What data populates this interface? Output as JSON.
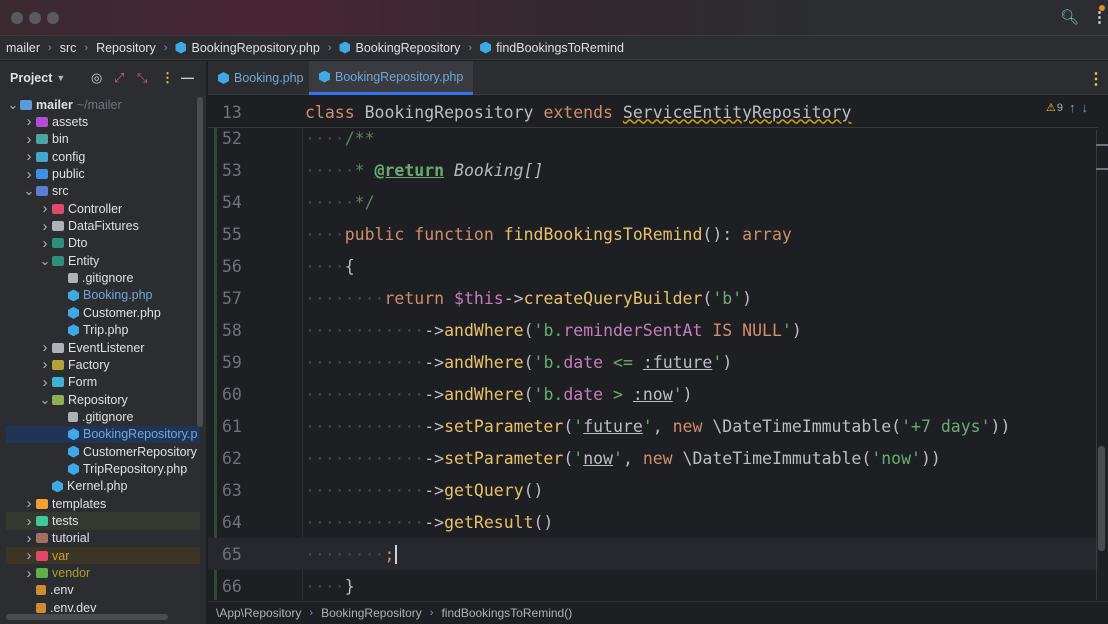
{
  "breadcrumb": [
    "mailer",
    "src",
    "Repository",
    "BookingRepository.php",
    "BookingRepository",
    "findBookingsToRemind"
  ],
  "project_panel": {
    "title": "Project",
    "tree": [
      {
        "label": "mailer",
        "hint": "~/mailer",
        "level": 0,
        "open": true,
        "color": "#5b9bd5"
      },
      {
        "label": "assets",
        "level": 1,
        "color": "#b04fd6"
      },
      {
        "label": "bin",
        "level": 1,
        "color": "#4aa6a6"
      },
      {
        "label": "config",
        "level": 1,
        "color": "#3fa9c9"
      },
      {
        "label": "public",
        "level": 1,
        "color": "#3f8fe6"
      },
      {
        "label": "src",
        "level": 1,
        "open": true,
        "color": "#5b7dd6"
      },
      {
        "label": "Controller",
        "level": 2,
        "color": "#e0476a"
      },
      {
        "label": "DataFixtures",
        "level": 2,
        "color": "#aeb1b6"
      },
      {
        "label": "Dto",
        "level": 2,
        "color": "#2f8f7a"
      },
      {
        "label": "Entity",
        "level": 2,
        "open": true,
        "color": "#2f8f7a"
      },
      {
        "label": ".gitignore",
        "level": 3,
        "leaf": true,
        "color": "#aeb1b6"
      },
      {
        "label": "Booking.php",
        "level": 3,
        "leaf": true,
        "php": true,
        "text": "#6fa8dc"
      },
      {
        "label": "Customer.php",
        "level": 3,
        "leaf": true,
        "php": true
      },
      {
        "label": "Trip.php",
        "level": 3,
        "leaf": true,
        "php": true
      },
      {
        "label": "EventListener",
        "level": 2,
        "color": "#aeb1b6"
      },
      {
        "label": "Factory",
        "level": 2,
        "color": "#b2a33a"
      },
      {
        "label": "Form",
        "level": 2,
        "color": "#3fb0d6"
      },
      {
        "label": "Repository",
        "level": 2,
        "open": true,
        "color": "#8fae5a"
      },
      {
        "label": ".gitignore",
        "level": 3,
        "leaf": true,
        "color": "#aeb1b6"
      },
      {
        "label": "BookingRepository.p",
        "level": 3,
        "leaf": true,
        "php": true,
        "selected": true,
        "text": "#6fa8dc"
      },
      {
        "label": "CustomerRepository",
        "level": 3,
        "leaf": true,
        "php": true
      },
      {
        "label": "TripRepository.php",
        "level": 3,
        "leaf": true,
        "php": true
      },
      {
        "label": "Kernel.php",
        "level": 2,
        "leaf": true,
        "php": true
      },
      {
        "label": "templates",
        "level": 1,
        "color": "#f0a030"
      },
      {
        "label": "tests",
        "level": 1,
        "color": "#3fc99a",
        "bg": "#33392f"
      },
      {
        "label": "tutorial",
        "level": 1,
        "color": "#a07060"
      },
      {
        "label": "var",
        "level": 1,
        "color": "#e0476a",
        "bg": "#3b3525",
        "text": "#c7a03a"
      },
      {
        "label": "vendor",
        "level": 1,
        "color": "#5fae4a",
        "text": "#a8a030"
      },
      {
        "label": ".env",
        "level": 1,
        "leaf": true,
        "color": "#d08a30"
      },
      {
        "label": ".env.dev",
        "level": 1,
        "leaf": true,
        "color": "#d08a30"
      }
    ]
  },
  "tabs": [
    "Booking.php",
    "BookingRepository.php"
  ],
  "inspections": {
    "warnings": "9"
  },
  "sticky": {
    "line": "13",
    "tokens": [
      [
        "class",
        "kw"
      ],
      [
        " ",
        "ws"
      ],
      [
        "BookingRepository",
        "cls"
      ],
      [
        " ",
        "ws"
      ],
      [
        "extends",
        "kw"
      ],
      [
        " ",
        "ws"
      ],
      [
        "ServiceEntityRepository",
        "cls ul"
      ]
    ]
  },
  "lines": [
    {
      "n": "52",
      "t": [
        [
          "····",
          "ws"
        ],
        [
          "/**",
          "doc"
        ]
      ]
    },
    {
      "n": "53",
      "t": [
        [
          "·····",
          "ws"
        ],
        [
          "* ",
          "doc"
        ],
        [
          "@return",
          "tag"
        ],
        [
          " Booking[]",
          "dt"
        ]
      ]
    },
    {
      "n": "54",
      "t": [
        [
          "·····",
          "ws"
        ],
        [
          "*/",
          "doc"
        ]
      ]
    },
    {
      "n": "55",
      "t": [
        [
          "····",
          "ws"
        ],
        [
          "public",
          "kw"
        ],
        [
          " ",
          "ws"
        ],
        [
          "function",
          "kw"
        ],
        [
          " findBookingsToRemind",
          "fn"
        ],
        [
          "(): ",
          "op"
        ],
        [
          "array",
          "kw"
        ]
      ]
    },
    {
      "n": "56",
      "t": [
        [
          "····",
          "ws"
        ],
        [
          "{",
          "op"
        ]
      ]
    },
    {
      "n": "57",
      "t": [
        [
          "········",
          "ws"
        ],
        [
          "return",
          "kw"
        ],
        [
          " ",
          "ws"
        ],
        [
          "$this",
          "var"
        ],
        [
          "->",
          "op"
        ],
        [
          "createQueryBuilder",
          "fn"
        ],
        [
          "(",
          "op"
        ],
        [
          "'b'",
          "str"
        ],
        [
          ")",
          "op"
        ]
      ]
    },
    {
      "n": "58",
      "t": [
        [
          "············",
          "ws"
        ],
        [
          "->",
          "op"
        ],
        [
          "andWhere",
          "fn"
        ],
        [
          "(",
          "op"
        ],
        [
          "'b.",
          "str"
        ],
        [
          "reminderSentAt",
          "sql"
        ],
        [
          " ",
          "ws"
        ],
        [
          "IS NULL",
          "kw"
        ],
        [
          "'",
          "str"
        ],
        [
          ")",
          "op"
        ]
      ]
    },
    {
      "n": "59",
      "t": [
        [
          "············",
          "ws"
        ],
        [
          "->",
          "op"
        ],
        [
          "andWhere",
          "fn"
        ],
        [
          "(",
          "op"
        ],
        [
          "'b.",
          "str"
        ],
        [
          "date",
          "sql"
        ],
        [
          " <= ",
          "str"
        ],
        [
          ":future",
          "param"
        ],
        [
          "'",
          "str"
        ],
        [
          ")",
          "op"
        ]
      ]
    },
    {
      "n": "60",
      "t": [
        [
          "············",
          "ws"
        ],
        [
          "->",
          "op"
        ],
        [
          "andWhere",
          "fn"
        ],
        [
          "(",
          "op"
        ],
        [
          "'b.",
          "str"
        ],
        [
          "date",
          "sql"
        ],
        [
          " > ",
          "str"
        ],
        [
          ":now",
          "param"
        ],
        [
          "'",
          "str"
        ],
        [
          ")",
          "op"
        ]
      ]
    },
    {
      "n": "61",
      "t": [
        [
          "············",
          "ws"
        ],
        [
          "->",
          "op"
        ],
        [
          "setParameter",
          "fn"
        ],
        [
          "(",
          "op"
        ],
        [
          "'",
          "str"
        ],
        [
          "future",
          "param"
        ],
        [
          "'",
          "str"
        ],
        [
          ", ",
          "op"
        ],
        [
          "new",
          "kw"
        ],
        [
          " \\DateTimeImmutable(",
          "op"
        ],
        [
          "'+7 days'",
          "str"
        ],
        [
          "))",
          "op"
        ]
      ]
    },
    {
      "n": "62",
      "t": [
        [
          "············",
          "ws"
        ],
        [
          "->",
          "op"
        ],
        [
          "setParameter",
          "fn"
        ],
        [
          "(",
          "op"
        ],
        [
          "'",
          "str"
        ],
        [
          "now",
          "param"
        ],
        [
          "'",
          "str"
        ],
        [
          ", ",
          "op"
        ],
        [
          "new",
          "kw"
        ],
        [
          " \\DateTimeImmutable(",
          "op"
        ],
        [
          "'now'",
          "str"
        ],
        [
          "))",
          "op"
        ]
      ]
    },
    {
      "n": "63",
      "t": [
        [
          "············",
          "ws"
        ],
        [
          "->",
          "op"
        ],
        [
          "getQuery",
          "fn"
        ],
        [
          "()",
          "op"
        ]
      ]
    },
    {
      "n": "64",
      "t": [
        [
          "············",
          "ws"
        ],
        [
          "->",
          "op"
        ],
        [
          "getResult",
          "fn"
        ],
        [
          "()",
          "op"
        ]
      ]
    },
    {
      "n": "65",
      "t": [
        [
          "········",
          "ws"
        ],
        [
          ";",
          "kw"
        ]
      ],
      "current": true
    },
    {
      "n": "66",
      "t": [
        [
          "····",
          "ws"
        ],
        [
          "}",
          "op"
        ]
      ]
    }
  ],
  "status_crumbs": [
    "\\App\\Repository",
    "BookingRepository",
    "findBookingsToRemind()"
  ]
}
